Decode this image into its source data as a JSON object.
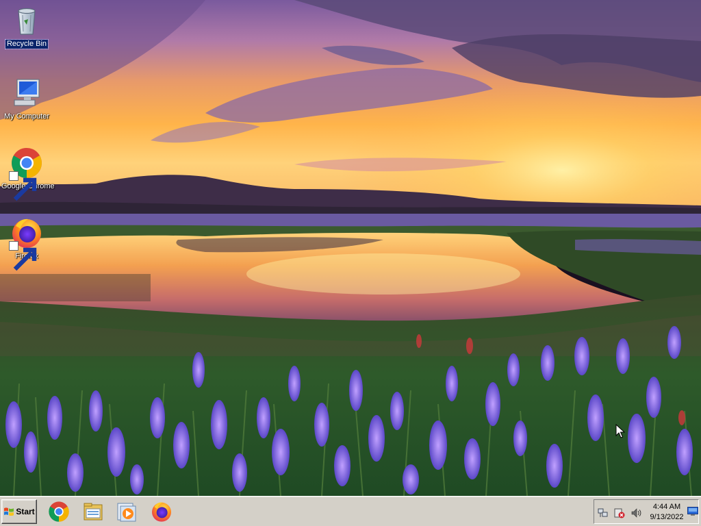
{
  "desktop": {
    "wallpaper_name": "sunset-lake-lavender-field",
    "icons": [
      {
        "label": "Recycle Bin",
        "icon": "recycle-bin-icon",
        "selected": true,
        "shortcut": false
      },
      {
        "label": "My Computer",
        "icon": "computer-icon",
        "selected": false,
        "shortcut": false
      },
      {
        "label": "Google Chrome",
        "icon": "chrome-icon",
        "selected": false,
        "shortcut": true
      },
      {
        "label": "Firefox",
        "icon": "firefox-icon",
        "selected": false,
        "shortcut": true
      }
    ]
  },
  "taskbar": {
    "start_label": "Start",
    "quick_launch": [
      {
        "name": "Google Chrome",
        "icon": "chrome-icon"
      },
      {
        "name": "Windows Explorer",
        "icon": "folder-icon"
      },
      {
        "name": "Windows Media Player",
        "icon": "media-player-icon"
      },
      {
        "name": "Firefox",
        "icon": "firefox-icon"
      }
    ],
    "tray": {
      "icons": [
        "network-icon",
        "security-alert-icon",
        "volume-icon"
      ],
      "time": "4:44 AM",
      "date": "9/13/2022"
    }
  },
  "colors": {
    "taskbar_bg": "#d4d0c8",
    "selection_bg": "#0a246a",
    "label_text": "#ffffff"
  }
}
